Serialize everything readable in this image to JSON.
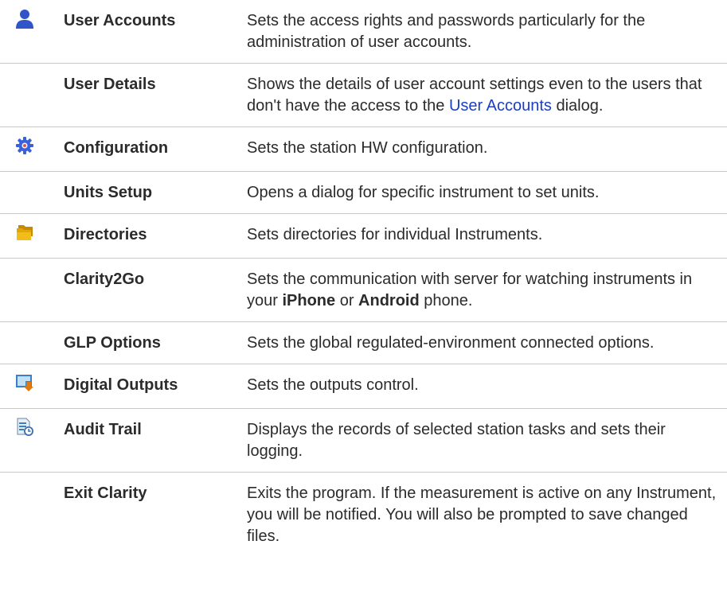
{
  "rows": [
    {
      "icon": "user-icon",
      "name": "User Accounts",
      "desc": "Sets the access rights and passwords particularly for the administration of user accounts."
    },
    {
      "icon": "",
      "name": "User Details",
      "desc_pre": "Shows the details of user account settings even to the users that don't have the access to the ",
      "desc_link": "User Accounts",
      "desc_post": " dialog."
    },
    {
      "icon": "gear-icon",
      "name": "Configuration",
      "desc": "Sets the station HW configuration."
    },
    {
      "icon": "",
      "name": "Units Setup",
      "desc": "Opens a dialog for specific instrument to set units."
    },
    {
      "icon": "folders-icon",
      "name": "Directories",
      "desc": "Sets directories for individual Instruments."
    },
    {
      "icon": "",
      "name": "Clarity2Go",
      "desc_pre": "Sets the communication with server for watching instruments in your ",
      "desc_b1": "iPhone",
      "desc_mid": " or ",
      "desc_b2": "Android",
      "desc_post": " phone."
    },
    {
      "icon": "",
      "name": "GLP Options",
      "desc": "Sets the global regulated-environment connected options."
    },
    {
      "icon": "digital-output-icon",
      "name": "Digital Outputs",
      "desc": "Sets the outputs control."
    },
    {
      "icon": "audit-trail-icon",
      "name": "Audit Trail",
      "desc": "Displays the records of selected station tasks and sets their logging."
    },
    {
      "icon": "",
      "name": "Exit Clarity",
      "desc": "Exits the program. If the measurement is active on any Instrument, you will be notified. You will also be prompted to save changed files."
    }
  ],
  "colors": {
    "text": "#2b2b2b",
    "link": "#1a3ec4",
    "divider": "#c8c8c8",
    "user_icon": "#2f55c8",
    "gear_icon": "#3a62d8",
    "folder_icon": "#e0a800",
    "output_icon": "#3b7fc4",
    "output_arrow": "#e07a10"
  }
}
